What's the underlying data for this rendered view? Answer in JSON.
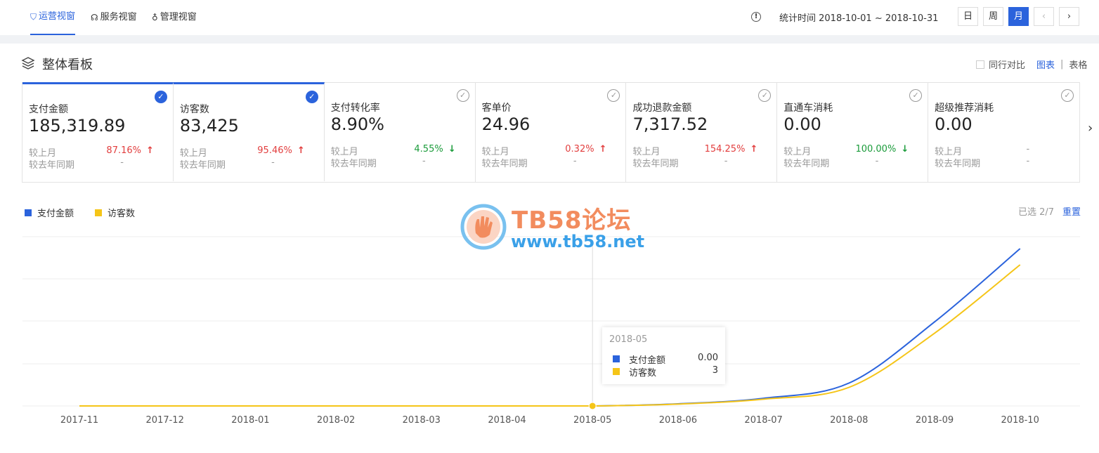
{
  "topbar": {
    "tabs": [
      {
        "label": "运营视窗",
        "active": true,
        "icon": "shield-icon"
      },
      {
        "label": "服务视窗",
        "active": false,
        "icon": "headset-icon"
      },
      {
        "label": "管理视窗",
        "active": false,
        "icon": "key-icon"
      }
    ],
    "stat_time": "统计时间 2018-10-01 ~ 2018-10-31",
    "period_buttons": [
      "日",
      "周",
      "月"
    ],
    "active_period": "月"
  },
  "panel": {
    "title": "整体看板",
    "compare_label": "同行对比",
    "view_chart": "图表",
    "view_sep": "|",
    "view_table": "表格"
  },
  "metrics": [
    {
      "name": "支付金额",
      "value": "185,319.89",
      "selected": true,
      "mom_label": "较上月",
      "mom": "87.16%",
      "trend": "up",
      "yoy_label": "较去年同期",
      "yoy": "-"
    },
    {
      "name": "访客数",
      "value": "83,425",
      "selected": true,
      "mom_label": "较上月",
      "mom": "95.46%",
      "trend": "up",
      "yoy_label": "较去年同期",
      "yoy": "-"
    },
    {
      "name": "支付转化率",
      "value": "8.90%",
      "selected": false,
      "mom_label": "较上月",
      "mom": "4.55%",
      "trend": "down",
      "yoy_label": "较去年同期",
      "yoy": "-"
    },
    {
      "name": "客单价",
      "value": "24.96",
      "selected": false,
      "mom_label": "较上月",
      "mom": "0.32%",
      "trend": "up",
      "yoy_label": "较去年同期",
      "yoy": "-"
    },
    {
      "name": "成功退款金额",
      "value": "7,317.52",
      "selected": false,
      "mom_label": "较上月",
      "mom": "154.25%",
      "trend": "up",
      "yoy_label": "较去年同期",
      "yoy": "-"
    },
    {
      "name": "直通车消耗",
      "value": "0.00",
      "selected": false,
      "mom_label": "较上月",
      "mom": "100.00%",
      "trend": "down",
      "yoy_label": "较去年同期",
      "yoy": "-"
    },
    {
      "name": "超级推荐消耗",
      "value": "0.00",
      "selected": false,
      "mom_label": "较上月",
      "mom": "-",
      "trend": "none",
      "yoy_label": "较去年同期",
      "yoy": "-"
    }
  ],
  "legend": [
    {
      "name": "支付金额",
      "color": "#2b63dc"
    },
    {
      "name": "访客数",
      "color": "#f5c518"
    }
  ],
  "selection": {
    "text": "已选 2/7",
    "reset": "重置"
  },
  "watermark": {
    "title": "TB58论坛",
    "url": "www.tb58.net"
  },
  "tooltip": {
    "title": "2018-05",
    "rows": [
      {
        "name": "支付金额",
        "value": "0.00",
        "color": "#2b63dc"
      },
      {
        "name": "访客数",
        "value": "3",
        "color": "#f5c518"
      }
    ]
  },
  "chart_data": {
    "type": "line",
    "x": [
      "2017-11",
      "2017-12",
      "2018-01",
      "2018-02",
      "2018-03",
      "2018-04",
      "2018-05",
      "2018-06",
      "2018-07",
      "2018-08",
      "2018-09",
      "2018-10"
    ],
    "series": [
      {
        "name": "支付金额",
        "color": "#2b63dc",
        "values": [
          0,
          0,
          0,
          0,
          0,
          0,
          0,
          2500,
          9000,
          27000,
          99000,
          185319.89
        ]
      },
      {
        "name": "访客数",
        "color": "#f5c518",
        "values": [
          0,
          0,
          0,
          0,
          0,
          0,
          3,
          1100,
          4000,
          11000,
          43000,
          83425
        ]
      }
    ],
    "highlight_index": 6,
    "grid": true,
    "legend_position": "top-left"
  }
}
